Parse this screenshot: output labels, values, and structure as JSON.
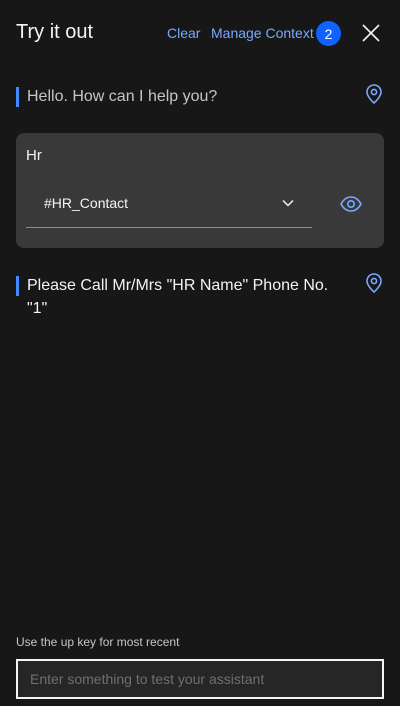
{
  "header": {
    "title": "Try it out",
    "clear_label": "Clear",
    "manage_context_label": "Manage Context",
    "context_count": "2",
    "close_icon": "close-icon"
  },
  "messages": [
    {
      "text": "Hello. How can I help you?",
      "icon": "location-pin-icon"
    },
    {
      "text": "Please Call Mr/Mrs \"HR Name\" Phone No. \"1\"",
      "icon": "location-pin-icon"
    }
  ],
  "card": {
    "title": "Hr",
    "dropdown_value": "#HR_Contact",
    "dropdown_icon": "chevron-down-icon",
    "view_icon": "eye-icon"
  },
  "input": {
    "hint": "Use the up key for most recent",
    "placeholder": "Enter something to test your assistant",
    "value": ""
  },
  "colors": {
    "background": "#171717",
    "card": "#393939",
    "accent": "#4589ff",
    "link": "#78a9ff",
    "badge": "#0f62fe"
  }
}
